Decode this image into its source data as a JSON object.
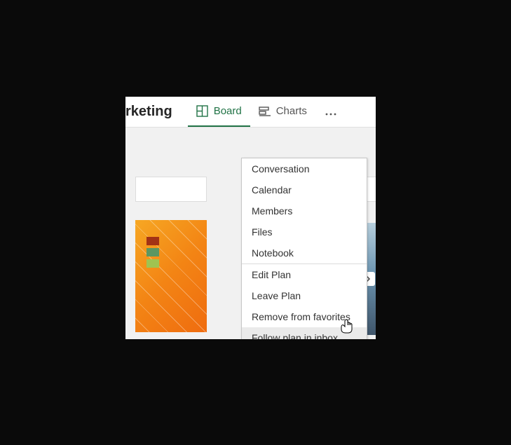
{
  "header": {
    "plan_name_partial": "rketing",
    "tabs": {
      "board": {
        "label": "Board",
        "active": true
      },
      "charts": {
        "label": "Charts",
        "active": false
      }
    },
    "more_label": "..."
  },
  "menu": {
    "group1": [
      {
        "label": "Conversation"
      },
      {
        "label": "Calendar"
      },
      {
        "label": "Members"
      },
      {
        "label": "Files"
      },
      {
        "label": "Notebook"
      }
    ],
    "group2": [
      {
        "label": "Edit Plan"
      },
      {
        "label": "Leave Plan"
      },
      {
        "label": "Remove from favorites"
      },
      {
        "label": "Follow plan in inbox",
        "hovered": true
      }
    ]
  }
}
